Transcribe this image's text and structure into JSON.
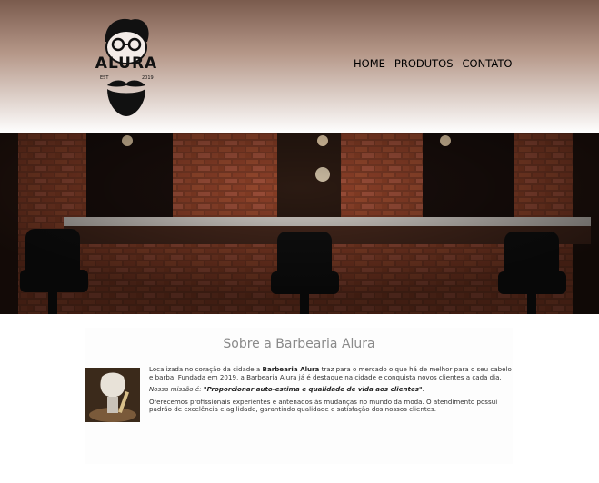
{
  "brand": {
    "name": "ALURA",
    "est": "EST",
    "year": "2019"
  },
  "nav": {
    "items": [
      "HOME",
      "PRODUTOS",
      "CONTATO"
    ]
  },
  "banner": {
    "alt": "Interior da barbearia"
  },
  "about": {
    "title": "Sobre a Barbearia Alura",
    "p1_before": "Localizada no coração da cidade a ",
    "p1_strong": "Barbearia Alura",
    "p1_after": " traz para o mercado o que há de melhor para o seu cabelo e barba. Fundada em 2019, a Barbearia Alura já é destaque na cidade e conquista novos clientes a cada dia.",
    "mission_label": "Nossa missão é: ",
    "mission_text": "\"Proporcionar auto-estima e qualidade de vida aos clientes\"",
    "mission_end": ".",
    "p3": "Oferecemos profissionais experientes e antenados às mudanças no mundo da moda. O atendimento possui padrão de excelência e agilidade, garantindo qualidade e satisfação dos nossos clientes."
  },
  "colors": {
    "header_top": "#7a5b4d",
    "title_gray": "#8a8a8a",
    "brick": "#8c3a22"
  }
}
